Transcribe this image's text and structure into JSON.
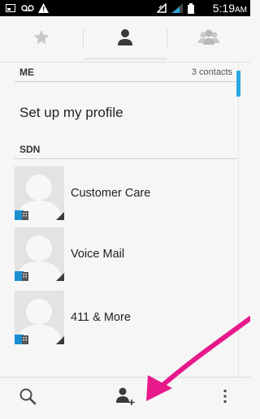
{
  "status_bar": {
    "time": "5:19",
    "ampm": "AM",
    "icons": [
      "screenshot-icon",
      "voicemail-icon",
      "warning-icon",
      "data-icon",
      "signal-icon",
      "battery-icon"
    ]
  },
  "tabs": [
    {
      "icon": "star-icon",
      "selected": false
    },
    {
      "icon": "person-icon",
      "selected": true
    },
    {
      "icon": "group-icon",
      "selected": false
    }
  ],
  "me_section": {
    "header": "ME",
    "count": "3 contacts",
    "profile_label": "Set up my profile"
  },
  "sdn_section": {
    "header": "SDN",
    "contacts": [
      {
        "name": "Customer Care"
      },
      {
        "name": "Voice Mail"
      },
      {
        "name": "411 & More"
      }
    ]
  },
  "bottom_bar": {
    "icons": [
      "search-icon",
      "add-contact-icon",
      "overflow-menu-icon"
    ]
  },
  "colors": {
    "accent": "#29a8e0",
    "arrow": "#e8198b",
    "sim_badge": "#1a8fd0"
  }
}
